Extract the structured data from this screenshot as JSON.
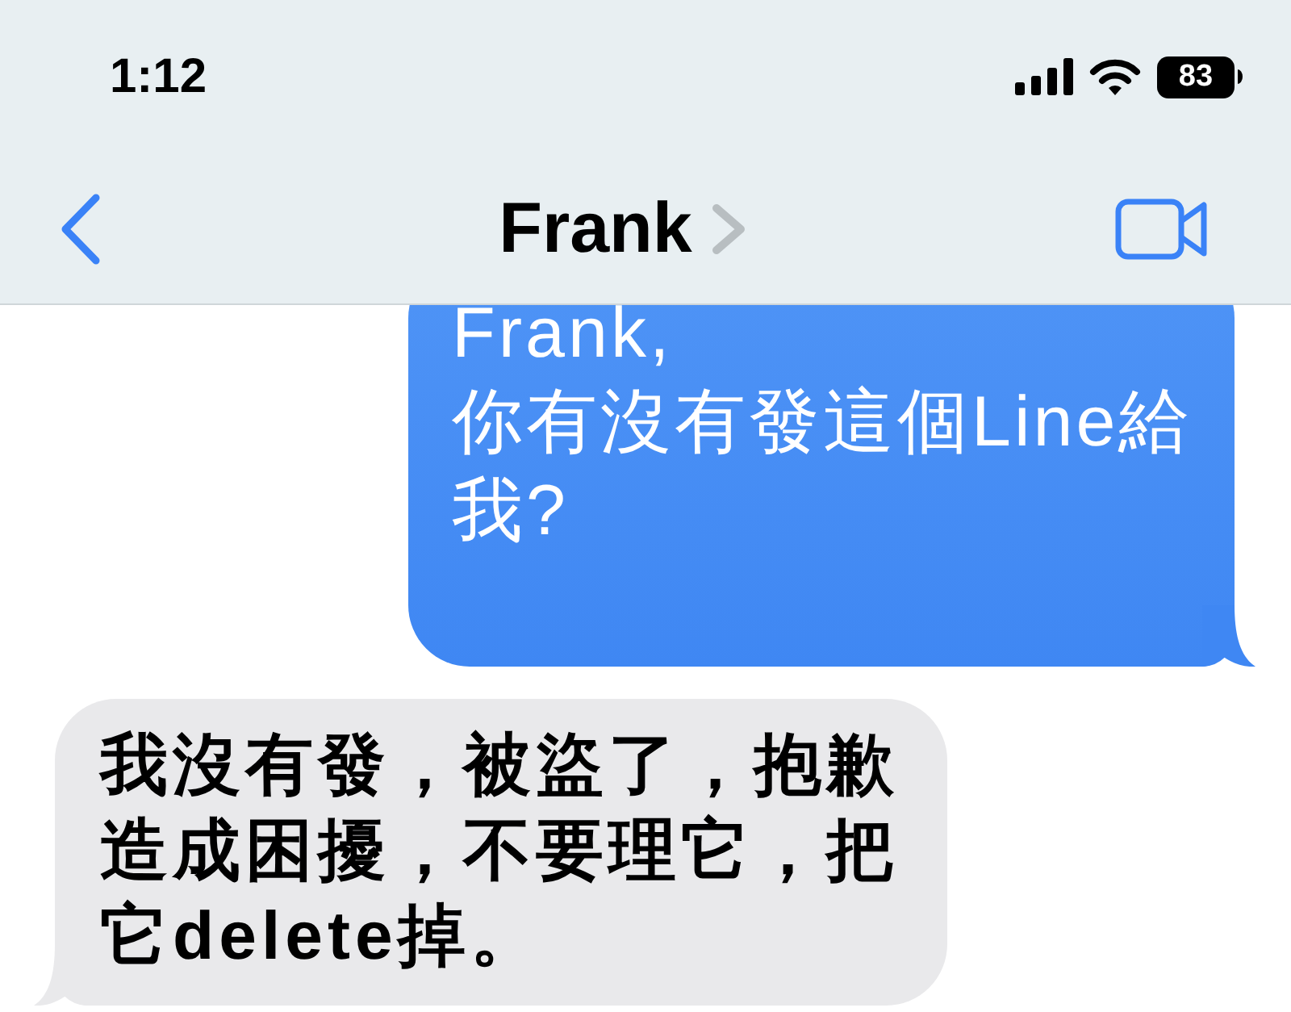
{
  "status_bar": {
    "time": "1:12",
    "battery": "83"
  },
  "header": {
    "contact_name": "Frank"
  },
  "messages": [
    {
      "kind": "outgoing",
      "lines": [
        "Frank,",
        "你有沒有發這個Line給",
        "我?"
      ]
    },
    {
      "kind": "incoming",
      "lines": [
        "我沒有發，被盜了，抱歉",
        "造成困擾，不要理它，把",
        "它delete掉。"
      ]
    }
  ]
}
